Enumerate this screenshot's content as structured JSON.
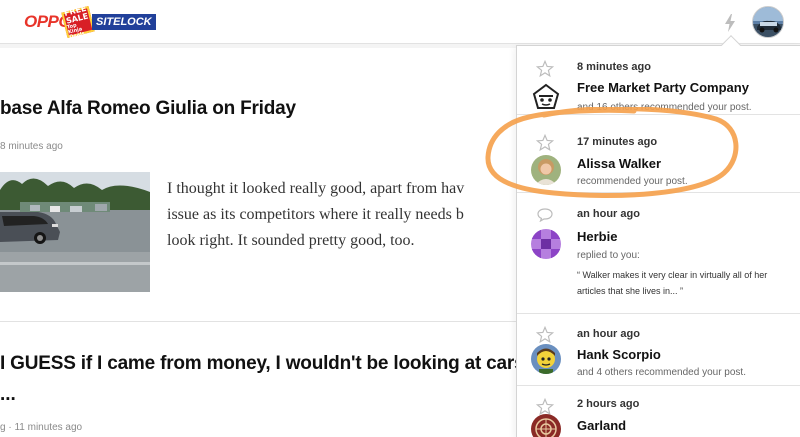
{
  "header": {
    "logo_text": "OPPO",
    "badge_line1": "FREE",
    "badge_line2": "SALE",
    "badge_line3": "Top Kinja Deals",
    "sitelock_text": "SITELOCK"
  },
  "feed": {
    "posts": [
      {
        "title": "base Alfa Romeo Giulia on Friday",
        "meta": "8 minutes ago",
        "excerpt_lines": [
          "I thought it looked really good, apart from hav",
          "issue as its competitors where it really needs b",
          "look right. It sounded pretty good, too."
        ]
      },
      {
        "title": "I GUESS if I came from money, I wouldn't be looking at cars",
        "ellipsis": "...",
        "meta_prefix": "g",
        "meta": "11 minutes ago"
      }
    ]
  },
  "notifications": [
    {
      "time": "8 minutes ago",
      "name": "Free Market Party Company",
      "desc": "and 16 others recommended your post.",
      "icon": "star-icon",
      "avatar": "pentagon-face-avatar"
    },
    {
      "time": "17 minutes ago",
      "name": "Alissa Walker",
      "desc": "recommended your post.",
      "icon": "star-icon",
      "avatar": "photo-avatar"
    },
    {
      "time": "an hour ago",
      "name": "Herbie",
      "desc": "replied to you:",
      "quote": "“ Walker makes it very clear in virtually all of her articles that she lives in... ”",
      "icon": "speech-bubble-icon",
      "avatar": "purple-pattern-avatar"
    },
    {
      "time": "an hour ago",
      "name": "Hank Scorpio",
      "desc": "and 4 others recommended your post.",
      "icon": "star-icon",
      "avatar": "cartoon-avatar"
    },
    {
      "time": "2 hours ago",
      "name": "Garland",
      "desc": "",
      "icon": "star-icon",
      "avatar": "red-emblem-avatar"
    }
  ],
  "colors": {
    "highlight": "#f5a04a",
    "logo_red": "#e8342a",
    "sitelock_blue": "#21409a",
    "herbie_purple": "#8c44c6"
  }
}
